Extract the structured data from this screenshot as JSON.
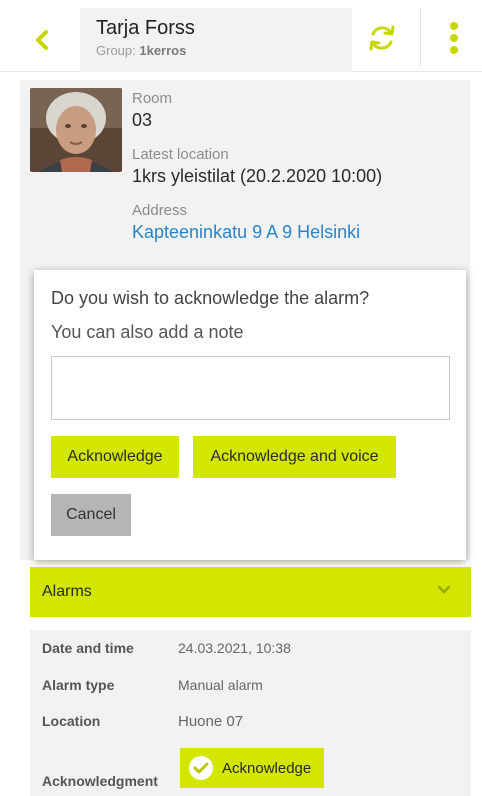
{
  "header": {
    "name": "Tarja Forss",
    "group_prefix": "Group: ",
    "group_name": "1kerros",
    "icons": {
      "back": "chevron-left-icon",
      "sync": "sync-icon",
      "more": "more-vertical-icon"
    },
    "accent_color": "#c6d800"
  },
  "resident": {
    "avatar": "resident-photo",
    "room_label": "Room",
    "room_value": "03",
    "location_label": "Latest location",
    "location_value": "1krs yleistilat (20.2.2020 10:00)",
    "address_label": "Address",
    "address_value": "Kapteeninkatu 9 A 9 Helsinki"
  },
  "dialog": {
    "question": "Do you wish to acknowledge the alarm?",
    "note_prompt": "You can also add a note",
    "note_value": "",
    "acknowledge_label": "Acknowledge",
    "acknowledge_voice_label": "Acknowledge and voice",
    "cancel_label": "Cancel"
  },
  "alarms": {
    "title": "Alarms",
    "chevron_icon": "chevron-down-icon",
    "rows": [
      {
        "label": "Date and time",
        "value": "24.03.2021, 10:38"
      },
      {
        "label": "Alarm type",
        "value": "Manual alarm"
      },
      {
        "label": "Location",
        "value": "Huone 07"
      }
    ],
    "ack_label": "Acknowledgment",
    "ack_button_label": "Acknowledge",
    "ack_button_icon": "check-circle-icon"
  },
  "colors": {
    "accent": "#d2e600",
    "link": "#2a84c8",
    "warning_edge": "#d9781e",
    "cancel_gray": "#b5b5b5"
  }
}
